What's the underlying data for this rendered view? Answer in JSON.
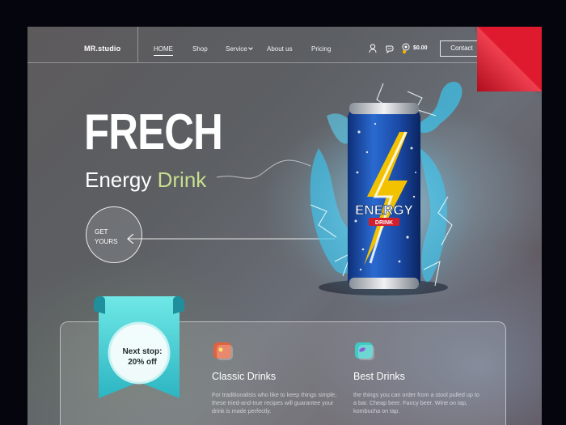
{
  "brand": "MR.studio",
  "nav": {
    "home": "HOME",
    "shop": "Shop",
    "service": "Service",
    "about": "About us",
    "pricing": "Pricing"
  },
  "header": {
    "cart_total": "$0.00",
    "contact_label": "Contact",
    "icons": [
      "user-icon",
      "chat-icon",
      "cart-icon"
    ]
  },
  "hero": {
    "title": "FRECH",
    "subtitle_word1": "Energy",
    "subtitle_word2": "Drink",
    "cta_line1": "GET",
    "cta_line2": "YOURS"
  },
  "product": {
    "can_brand": "ENERGY",
    "can_sub": "DRINK"
  },
  "promo": {
    "line1": "Next stop:",
    "line2": "20% off"
  },
  "features": [
    {
      "title": "Classic Drinks",
      "text": "For traditionalists who like to keep things simple, these tried-and-true recipes will guarantee your drink is made perfectly."
    },
    {
      "title": "Best Drinks",
      "text": "the things you can order from a stool pulled up to a bar. Cheap beer. Fancy beer. Wine on tap, kombucha on tap."
    }
  ],
  "colors": {
    "accent_green": "#c7de8f",
    "ribbon_teal": "#3fd3d3",
    "corner_red": "#e01a2e",
    "can_blue": "#1c4fa8"
  }
}
